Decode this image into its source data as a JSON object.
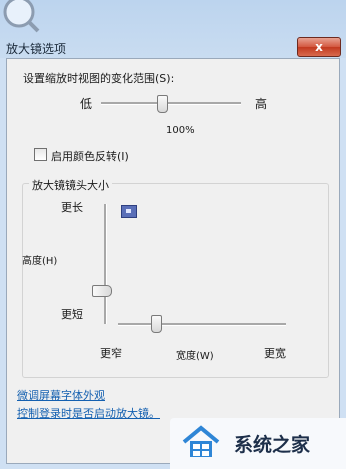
{
  "window": {
    "title": "放大镜选项",
    "close_glyph": "x"
  },
  "zoom": {
    "label": "设置缩放时视图的变化范围(S):",
    "min_label": "低",
    "max_label": "高",
    "value": "100%",
    "thumb_position": 0.5
  },
  "invert": {
    "label": "启用颜色反转(I)",
    "checked": false
  },
  "lens": {
    "group_title": "放大镜镜头大小",
    "height": {
      "longer_label": "更长",
      "axis_label": "高度(H)",
      "shorter_label": "更短",
      "level": 0.17
    },
    "width": {
      "narrower_label": "更窄",
      "axis_label": "宽度(W)",
      "wider_label": "更宽",
      "level": 0.2
    }
  },
  "links": {
    "font_appearance": "微调屏幕字体外观",
    "startup": "控制登录时是否启动放大镜。"
  },
  "watermark": {
    "text": "系统之家"
  }
}
